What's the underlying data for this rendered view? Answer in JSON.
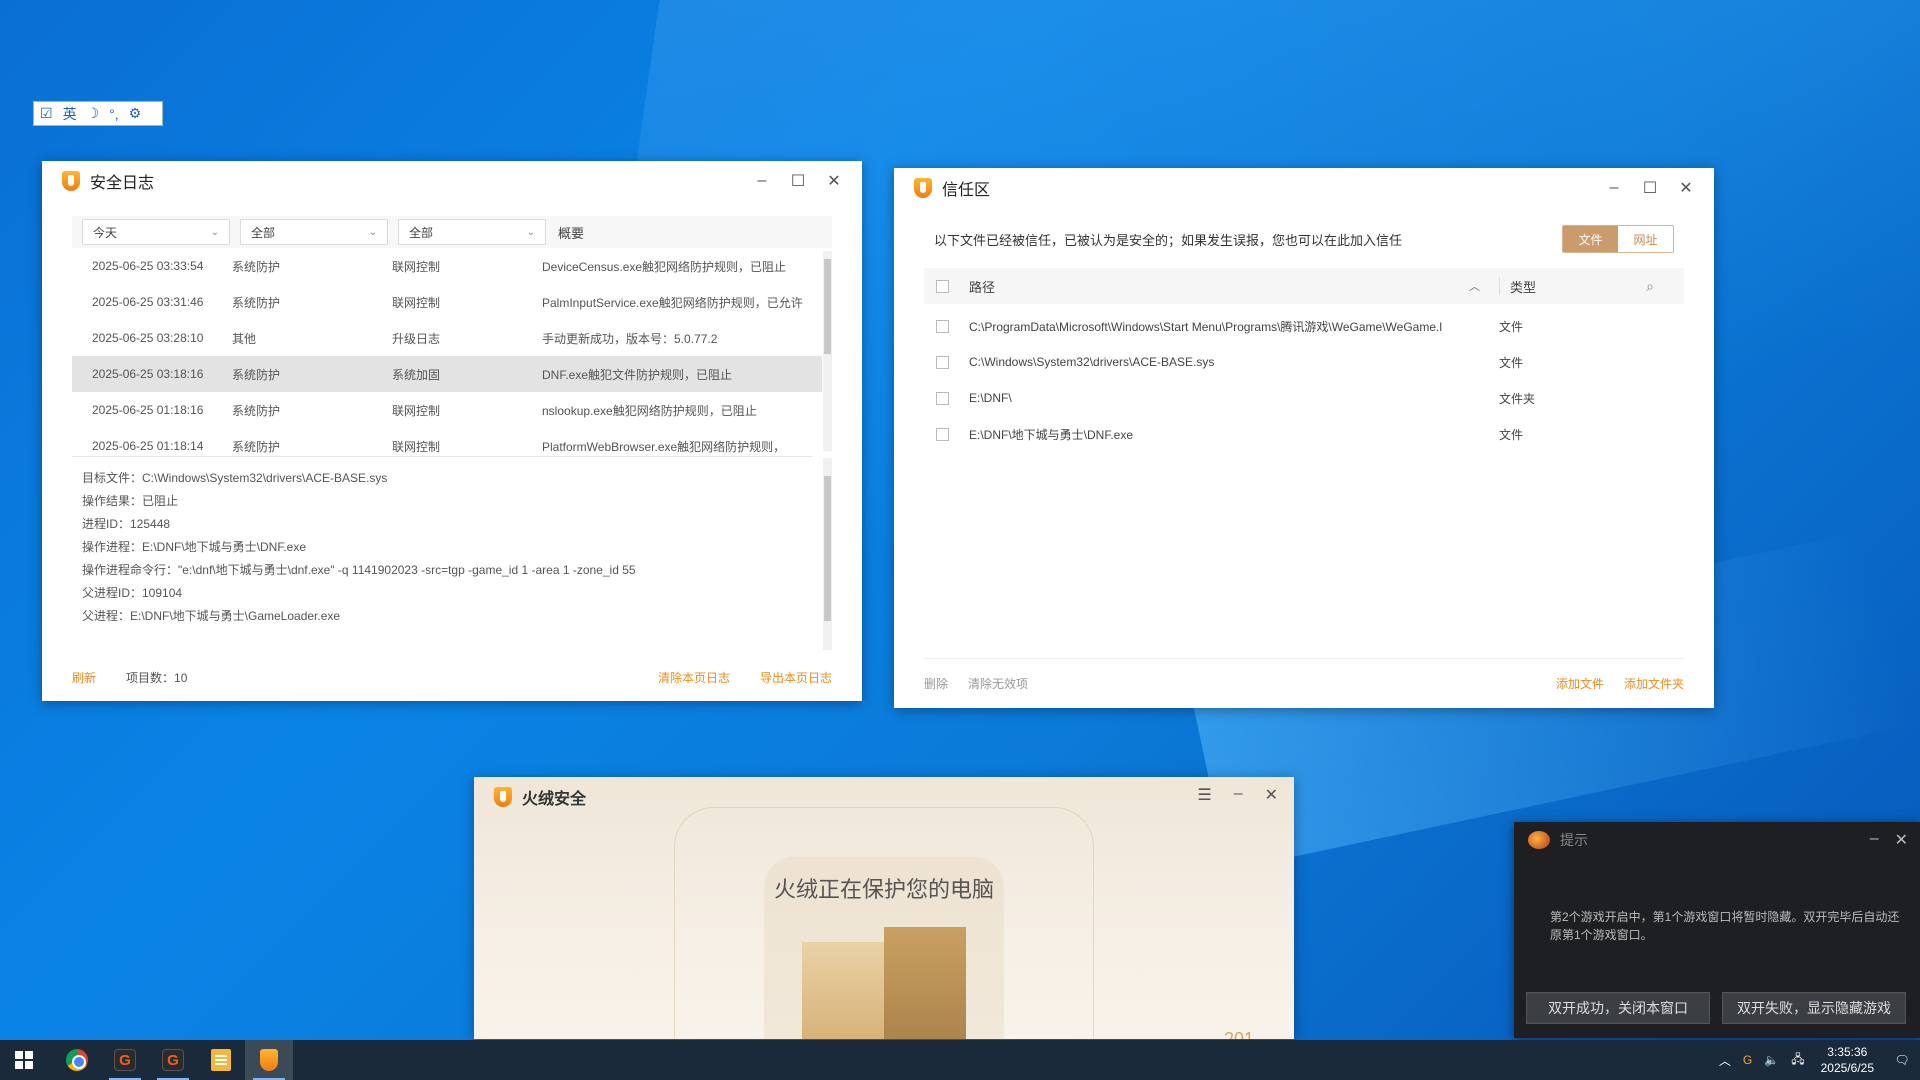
{
  "ime": {
    "items": [
      "☑",
      "英",
      "☽",
      "°,",
      "⚙"
    ]
  },
  "log_window": {
    "title": "安全日志",
    "filters": {
      "date": "今天",
      "category": "全部",
      "type": "全部",
      "overview_label": "概要"
    },
    "rows": [
      {
        "time": "2025-06-25 03:33:54",
        "category": "系统防护",
        "type": "联网控制",
        "summary": "DeviceCensus.exe触犯网络防护规则，已阻止"
      },
      {
        "time": "2025-06-25 03:31:46",
        "category": "系统防护",
        "type": "联网控制",
        "summary": "PalmInputService.exe触犯网络防护规则，已允许"
      },
      {
        "time": "2025-06-25 03:28:10",
        "category": "其他",
        "type": "升级日志",
        "summary": "手动更新成功，版本号：5.0.77.2"
      },
      {
        "time": "2025-06-25 03:18:16",
        "category": "系统防护",
        "type": "系统加固",
        "summary": "DNF.exe触犯文件防护规则，已阻止"
      },
      {
        "time": "2025-06-25 01:18:16",
        "category": "系统防护",
        "type": "联网控制",
        "summary": "nslookup.exe触犯网络防护规则，已阻止"
      },
      {
        "time": "2025-06-25 01:18:14",
        "category": "系统防护",
        "type": "联网控制",
        "summary": "PlatformWebBrowser.exe触犯网络防护规则，"
      }
    ],
    "detail_lines": [
      "目标文件：C:\\Windows\\System32\\drivers\\ACE-BASE.sys",
      "操作结果：已阻止",
      "",
      "进程ID：125448",
      "操作进程：E:\\DNF\\地下城与勇士\\DNF.exe",
      "操作进程命令行：\"e:\\dnf\\地下城与勇士\\dnf.exe\" -q 1141902023 -src=tgp -game_id 1 -area 1 -zone_id 55",
      "父进程ID：109104",
      "父进程：E:\\DNF\\地下城与勇士\\GameLoader.exe"
    ],
    "footer": {
      "refresh": "刷新",
      "count_label": "项目数：10",
      "clear": "清除本页日志",
      "export": "导出本页日志"
    }
  },
  "trust_window": {
    "title": "信任区",
    "intro": "以下文件已经被信任，已被认为是安全的；如果发生误报，您也可以在此加入信任",
    "tabs": {
      "file": "文件",
      "url": "网址"
    },
    "headers": {
      "path": "路径",
      "type": "类型"
    },
    "rows": [
      {
        "path": "C:\\ProgramData\\Microsoft\\Windows\\Start Menu\\Programs\\腾讯游戏\\WeGame\\WeGame.l",
        "type": "文件"
      },
      {
        "path": "C:\\Windows\\System32\\drivers\\ACE-BASE.sys",
        "type": "文件"
      },
      {
        "path": "E:\\DNF\\",
        "type": "文件夹"
      },
      {
        "path": "E:\\DNF\\地下城与勇士\\DNF.exe",
        "type": "文件"
      }
    ],
    "footer": {
      "delete": "删除",
      "clear_invalid": "清除无效项",
      "add_file": "添加文件",
      "add_folder": "添加文件夹"
    }
  },
  "main_window": {
    "title": "火绒安全",
    "headline": "火绒正在保护您的电脑",
    "corner_number": "201"
  },
  "tip_popup": {
    "title": "提示",
    "message": "第2个游戏开启中，第1个游戏窗口将暂时隐藏。双开完毕后自动还原第1个游戏窗口。",
    "btn_success": "双开成功，关闭本窗口",
    "btn_fail": "双开失败，显示隐藏游戏"
  },
  "taskbar": {
    "clock_time": "3:35:36",
    "clock_date": "2025/6/25"
  }
}
